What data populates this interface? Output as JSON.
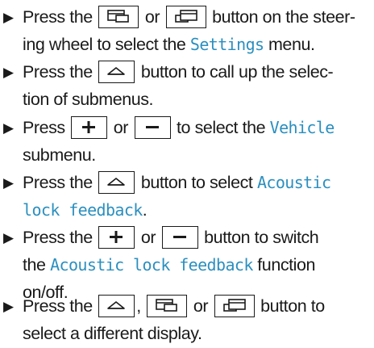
{
  "steps": [
    {
      "lines": [
        [
          "Press the ",
          {
            "key": "page-back-icon"
          },
          " or ",
          {
            "key": "page-forward-icon"
          },
          " button on the steer-"
        ],
        [
          "ing wheel to select the ",
          {
            "hl": "Settings"
          },
          " menu."
        ]
      ]
    },
    {
      "lines": [
        [
          "Press the ",
          {
            "key": "home-icon"
          },
          " button to call up the selec-"
        ],
        [
          "tion of submenus."
        ]
      ]
    },
    {
      "lines": [
        [
          "Press ",
          {
            "key": "plus-icon"
          },
          " or ",
          {
            "key": "minus-icon"
          },
          " to select the ",
          {
            "hl": "Vehicle"
          }
        ],
        [
          "submenu."
        ]
      ]
    },
    {
      "lines": [
        [
          "Press the ",
          {
            "key": "home-icon"
          },
          " button to select ",
          {
            "hl": "Acoustic"
          }
        ],
        [
          {
            "hl": "lock feedback"
          },
          "."
        ]
      ]
    },
    {
      "lines": [
        [
          "Press the ",
          {
            "key": "plus-icon"
          },
          " or ",
          {
            "key": "minus-icon"
          },
          " button to switch"
        ],
        [
          "the ",
          {
            "hl": "Acoustic lock feedback"
          },
          " function"
        ],
        [
          "on/off."
        ]
      ]
    },
    {
      "lines": [
        [
          "Press the ",
          {
            "key": "home-icon"
          },
          ", ",
          {
            "key": "page-back-icon"
          },
          " or ",
          {
            "key": "page-forward-icon"
          },
          " button to"
        ],
        [
          "select a different display."
        ]
      ]
    }
  ],
  "bullet_glyph": "▶",
  "highlight_color": "#2b8fbf"
}
